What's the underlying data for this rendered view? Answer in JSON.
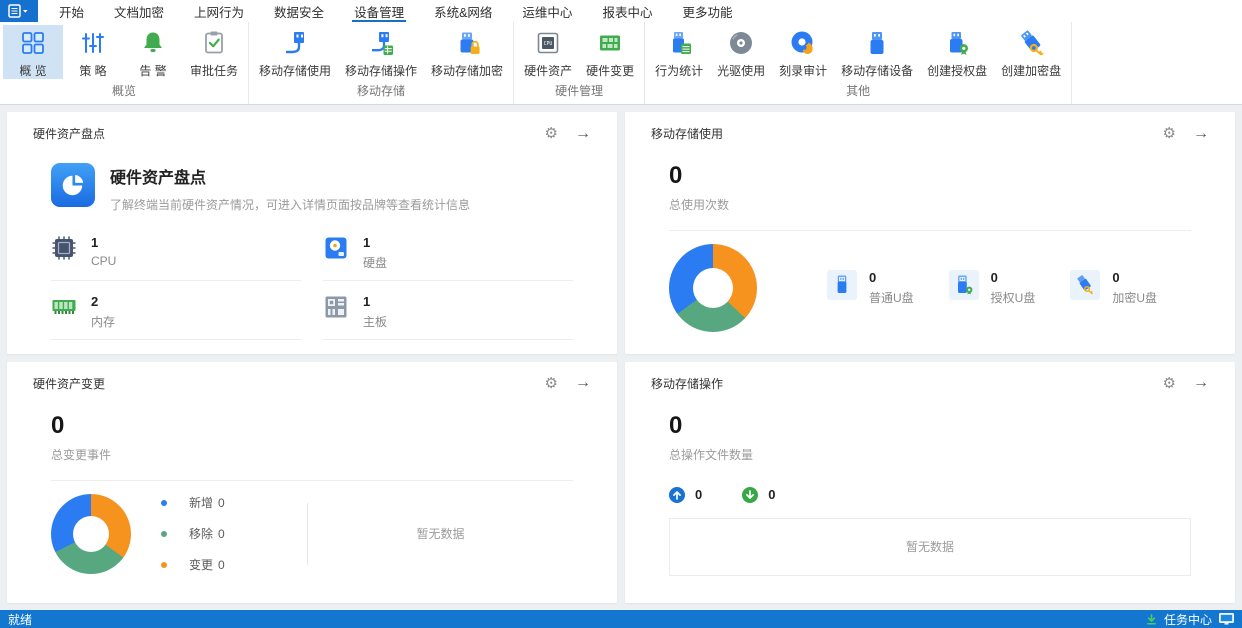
{
  "menu": {
    "active": "设备管理",
    "items": [
      {
        "label": "开始"
      },
      {
        "label": "文档加密"
      },
      {
        "label": "上网行为"
      },
      {
        "label": "数据安全"
      },
      {
        "label": "设备管理"
      },
      {
        "label": "系统&网络"
      },
      {
        "label": "运维中心"
      },
      {
        "label": "报表中心"
      },
      {
        "label": "更多功能"
      }
    ]
  },
  "ribbon": {
    "groups": [
      {
        "label": "概览",
        "items": [
          {
            "label": "概 览",
            "icon": "overview-grid-icon",
            "selected": true
          },
          {
            "label": "策 略",
            "icon": "policy-sliders-icon"
          },
          {
            "label": "告 警",
            "icon": "alarm-bell-icon"
          },
          {
            "label": "审批任务",
            "icon": "approval-clipboard-icon"
          }
        ]
      },
      {
        "label": "移动存储",
        "items": [
          {
            "label": "移动存储使用",
            "icon": "usb-plug-icon"
          },
          {
            "label": "移动存储操作",
            "icon": "usb-plug-grid-icon"
          },
          {
            "label": "移动存储加密",
            "icon": "usb-lock-icon"
          }
        ]
      },
      {
        "label": "硬件管理",
        "items": [
          {
            "label": "硬件资产",
            "icon": "cpu-chip-icon"
          },
          {
            "label": "硬件变更",
            "icon": "green-board-icon"
          }
        ]
      },
      {
        "label": "其他",
        "items": [
          {
            "label": "行为统计",
            "icon": "usb-calendar-icon"
          },
          {
            "label": "光驱使用",
            "icon": "cd-disc-icon"
          },
          {
            "label": "刻录审计",
            "icon": "burn-disc-flame-icon"
          },
          {
            "label": "移动存储设备",
            "icon": "usb-stick-icon"
          },
          {
            "label": "创建授权盘",
            "icon": "usb-badge-icon"
          },
          {
            "label": "创建加密盘",
            "icon": "usb-key-icon"
          }
        ]
      }
    ]
  },
  "icons": {
    "gear": "⚙",
    "arrow_right": "→"
  },
  "cards": {
    "hardware_inventory": {
      "title": "硬件资产盘点",
      "hero": {
        "title": "硬件资产盘点",
        "desc": "了解终端当前硬件资产情况，可进入详情页面按品牌等查看统计信息"
      },
      "stats": [
        {
          "value": "1",
          "label": "CPU",
          "icon": "cpu-icon"
        },
        {
          "value": "1",
          "label": "硬盘",
          "icon": "disk-icon"
        },
        {
          "value": "2",
          "label": "内存",
          "icon": "memory-icon"
        },
        {
          "value": "1",
          "label": "主板",
          "icon": "motherboard-icon"
        }
      ]
    },
    "storage_usage": {
      "title": "移动存储使用",
      "total_value": "0",
      "total_label": "总使用次数",
      "stats": [
        {
          "value": "0",
          "label": "普通U盘",
          "icon": "normal-usb-icon"
        },
        {
          "value": "0",
          "label": "授权U盘",
          "icon": "auth-usb-icon"
        },
        {
          "value": "0",
          "label": "加密U盘",
          "icon": "encrypt-usb-icon"
        }
      ],
      "chart_data": {
        "type": "pie",
        "categories": [
          "普通U盘",
          "授权U盘",
          "加密U盘"
        ],
        "values": [
          0,
          0,
          0
        ],
        "colors": [
          "#2b7cf2",
          "#57a880",
          "#f6921e"
        ],
        "display_segments": [
          {
            "color": "#f6921e",
            "deg": 133
          },
          {
            "color": "#57a880",
            "deg": 101
          },
          {
            "color": "#2b7cf2",
            "deg": 126
          }
        ]
      }
    },
    "hardware_change": {
      "title": "硬件资产变更",
      "total_value": "0",
      "total_label": "总变更事件",
      "legend": [
        {
          "label": "新增",
          "value": "0",
          "color": "#2b7cf2"
        },
        {
          "label": "移除",
          "value": "0",
          "color": "#57a880"
        },
        {
          "label": "变更",
          "value": "0",
          "color": "#f6921e"
        }
      ],
      "empty_text": "暂无数据",
      "chart_data": {
        "type": "pie",
        "categories": [
          "新增",
          "移除",
          "变更"
        ],
        "values": [
          0,
          0,
          0
        ],
        "colors": [
          "#2b7cf2",
          "#57a880",
          "#f6921e"
        ],
        "display_segments": [
          {
            "color": "#f6921e",
            "deg": 126
          },
          {
            "color": "#57a880",
            "deg": 117
          },
          {
            "color": "#2b7cf2",
            "deg": 117
          }
        ]
      }
    },
    "storage_operation": {
      "title": "移动存储操作",
      "total_value": "0",
      "total_label": "总操作文件数量",
      "upload_value": "0",
      "download_value": "0",
      "empty_text": "暂无数据"
    }
  },
  "statusbar": {
    "left": "就绪",
    "right": "任务中心"
  },
  "colors": {
    "accent_blue": "#1673d2",
    "statusbar_bg": "#1377d0",
    "ribbon_selected_bg": "#cfe3f5",
    "active_tab_underline": "#1a6fc0",
    "donut_blue": "#2b7cf2",
    "donut_green": "#57a880",
    "donut_orange": "#f6921e"
  }
}
